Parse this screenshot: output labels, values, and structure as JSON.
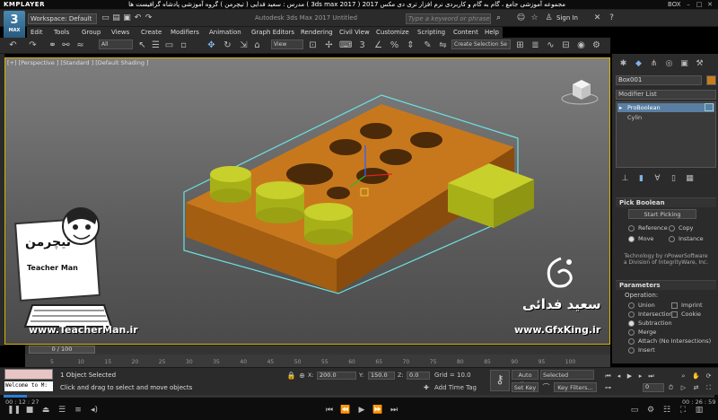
{
  "player": {
    "logo": "KMPLAYER",
    "title": "مجموعه آموزشی جامع ، گام به گام و کاربردی نرم افزار تری دی مکس 2017 ( 3ds max 2017 )  مدرس : سعید فدایی ( تیچرمن ) گروه آموزشی پادشاه گرافیست ها",
    "box_label": "BOX",
    "time_current": "00 : 12 : 27",
    "time_total": "00 : 26 : 59",
    "progress": 0.033
  },
  "app": {
    "logo_label": "MAX",
    "workspace": "Workspace: Default",
    "name": "Autodesk 3ds Max 2017   Untitled",
    "search_placeholder": "Type a keyword or phrase",
    "sign_in": "Sign In"
  },
  "menu": [
    "Edit",
    "Tools",
    "Group",
    "Views",
    "Create",
    "Modifiers",
    "Animation",
    "Graph Editors",
    "Rendering",
    "Civil View",
    "Customize",
    "Scripting",
    "Content",
    "Help"
  ],
  "toolbar": {
    "filter": "All",
    "ref_coord": "View",
    "selection_set": "Create Selection Se"
  },
  "viewport": {
    "label": "[+] [Perspective ] [Standard ] [Default Shading ]"
  },
  "command_panel": {
    "object_name": "Box001",
    "object_color": "#c87d1e",
    "modifier_list": "Modifier List",
    "stack": [
      "ProBoolean",
      "Cylin"
    ],
    "pick_boolean": {
      "header": "Pick Boolean",
      "start_picking": "Start Picking",
      "options": [
        {
          "label": "Reference",
          "on": false
        },
        {
          "label": "Copy",
          "on": false
        },
        {
          "label": "Move",
          "on": true
        },
        {
          "label": "Instance",
          "on": false
        }
      ],
      "note": "Technology by nPowerSoftware a Division of IntegrityWare, Inc."
    },
    "parameters": {
      "header": "Parameters",
      "operation_label": "Operation:",
      "ops": [
        {
          "label": "Union",
          "on": false
        },
        {
          "label": "Intersection",
          "on": false
        },
        {
          "label": "Subtraction",
          "on": true
        },
        {
          "label": "Merge",
          "on": false
        },
        {
          "label": "Attach (No Intersections)",
          "on": false
        },
        {
          "label": "Insert",
          "on": false
        }
      ],
      "checks": [
        "Imprint",
        "Cookie"
      ]
    }
  },
  "timeline": {
    "handle": "0 / 100",
    "ticks": [
      "5",
      "10",
      "15",
      "20",
      "25",
      "30",
      "35",
      "40",
      "45",
      "50",
      "55",
      "60",
      "65",
      "70",
      "75",
      "80",
      "85",
      "90",
      "95",
      "100"
    ]
  },
  "status": {
    "welcome": "Welcome to M:",
    "line1": "1 Object Selected",
    "line2": "Click and drag to select and move objects",
    "x_label": "X:",
    "x": "200.0",
    "y_label": "Y:",
    "y": "150.0",
    "z_label": "Z:",
    "z": "0.0",
    "grid": "Grid = 10.0",
    "add_time_tag": "Add Time Tag",
    "auto_key": "Auto Key",
    "set_key": "Set Key",
    "selected": "Selected",
    "key_filters": "Key Filters...",
    "frame": "0"
  },
  "overlay": {
    "teacher_brand": "تیچرمن",
    "teacher_name": "Teacher Man",
    "url1": "www.TeacherMan.ir",
    "name_fa": "سعید فدائی",
    "url2": "www.GfxKing.ir"
  }
}
